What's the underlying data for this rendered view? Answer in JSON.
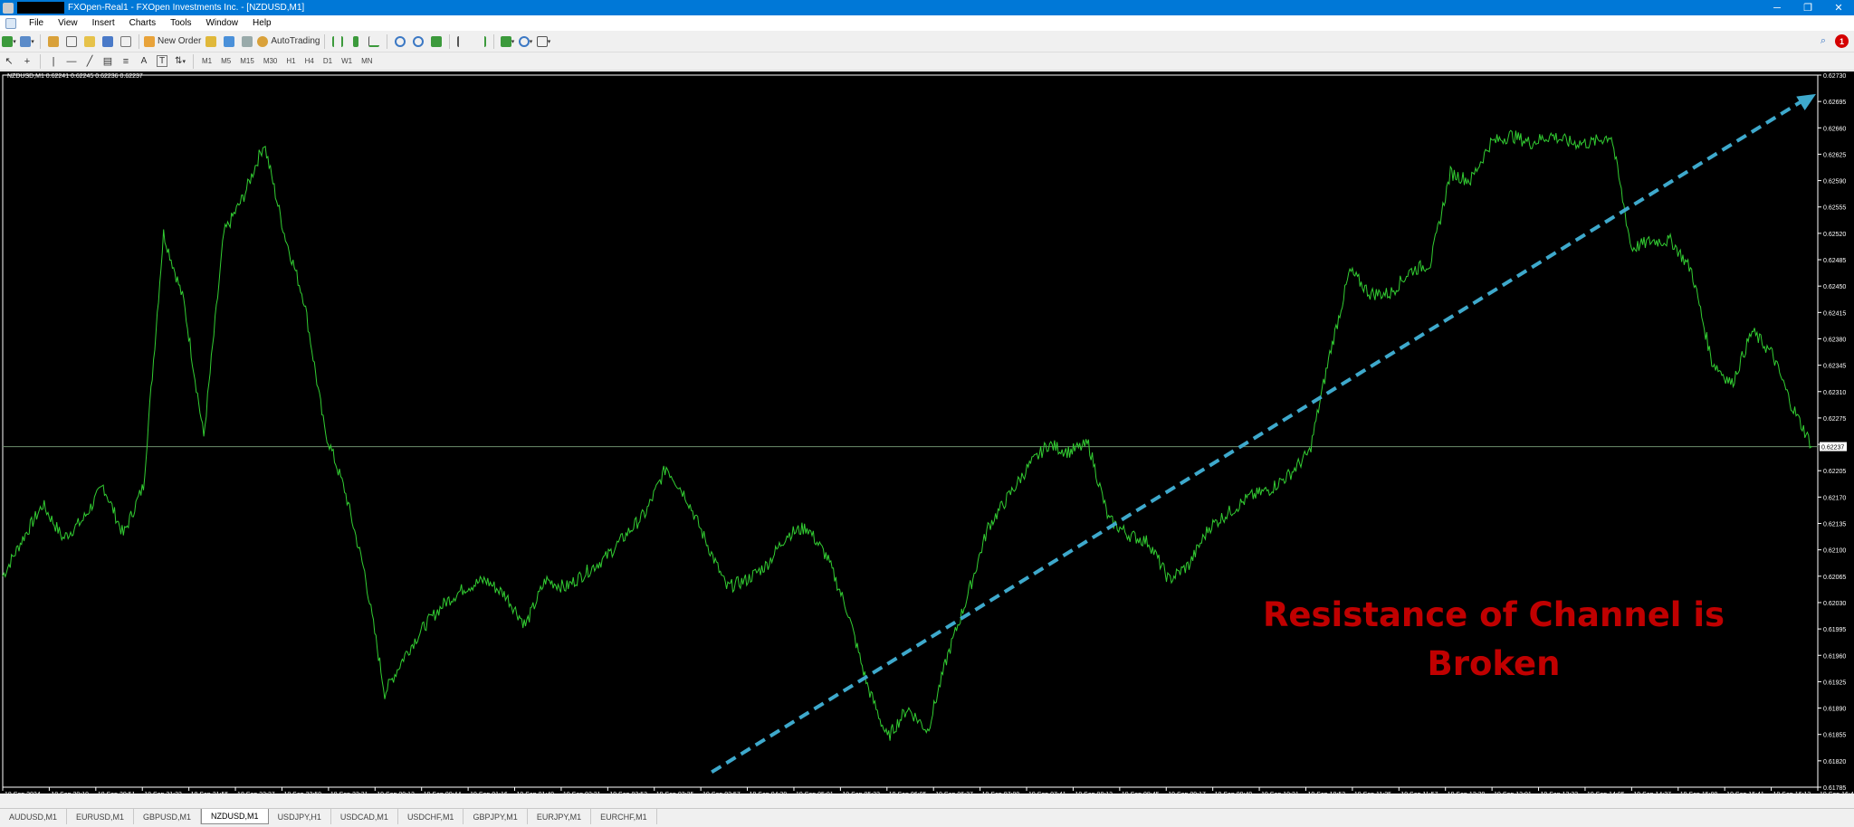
{
  "window": {
    "title": "FXOpen-Real1 - FXOpen Investments Inc. - [NZDUSD,M1]",
    "controls": [
      "─",
      "❐",
      "✕"
    ]
  },
  "menu": {
    "items": [
      "File",
      "View",
      "Insert",
      "Charts",
      "Tools",
      "Window",
      "Help"
    ]
  },
  "toolbar": {
    "new_order_label": "New Order",
    "autotrading_label": "AutoTrading",
    "notification_count": "1",
    "timeframes": [
      "M1",
      "M5",
      "M15",
      "M30",
      "H1",
      "H4",
      "D1",
      "W1",
      "MN"
    ],
    "text_tool": "A",
    "label_tool": "T"
  },
  "chart": {
    "info": "NZDUSD,M1  0.62241 0.62245 0.62236 0.62237",
    "current_price": "0.62237",
    "annotation_line1": "Resistance of Channel is",
    "annotation_line2": "Broken",
    "colors": {
      "background": "#000000",
      "line": "#32cd32",
      "trendline": "#3ea9cc",
      "annotation": "#c00000",
      "price_line": "#6b8e6b"
    }
  },
  "chart_data": {
    "type": "line",
    "symbol": "NZDUSD,M1",
    "ylim": [
      0.61785,
      0.6273
    ],
    "y_ticks": [
      "0.62730",
      "0.62695",
      "0.62660",
      "0.62625",
      "0.62590",
      "0.62555",
      "0.62520",
      "0.62485",
      "0.62450",
      "0.62415",
      "0.62380",
      "0.62345",
      "0.62310",
      "0.62275",
      "0.62240",
      "0.62205",
      "0.62170",
      "0.62135",
      "0.62100",
      "0.62065",
      "0.62030",
      "0.61995",
      "0.61960",
      "0.61925",
      "0.61890",
      "0.61855",
      "0.61820",
      "0.61785"
    ],
    "x_ticks": [
      "18 Sep 2024",
      "18 Sep 20:19",
      "18 Sep 20:51",
      "18 Sep 21:23",
      "18 Sep 21:55",
      "18 Sep 22:27",
      "18 Sep 22:59",
      "18 Sep 23:31",
      "19 Sep 00:12",
      "19 Sep 00:44",
      "19 Sep 01:16",
      "19 Sep 01:49",
      "19 Sep 02:21",
      "19 Sep 02:53",
      "19 Sep 03:25",
      "19 Sep 03:57",
      "19 Sep 04:29",
      "19 Sep 05:01",
      "19 Sep 05:33",
      "19 Sep 06:05",
      "19 Sep 06:37",
      "19 Sep 07:09",
      "19 Sep 07:41",
      "19 Sep 08:13",
      "19 Sep 08:45",
      "19 Sep 09:17",
      "19 Sep 09:49",
      "19 Sep 10:21",
      "19 Sep 10:53",
      "19 Sep 11:25",
      "19 Sep 11:57",
      "19 Sep 12:29",
      "19 Sep 13:01",
      "19 Sep 13:33",
      "19 Sep 14:05",
      "19 Sep 14:37",
      "19 Sep 15:09",
      "19 Sep 15:41",
      "19 Sep 16:13",
      "19 Sep 16:45"
    ],
    "series": [
      {
        "values": [
          0.62065,
          0.62115,
          0.6216,
          0.62115,
          0.6214,
          0.62185,
          0.6212,
          0.62185,
          0.6252,
          0.6243,
          0.6225,
          0.6252,
          0.6257,
          0.6264,
          0.6252,
          0.6243,
          0.6226,
          0.6218,
          0.6207,
          0.6191,
          0.6196,
          0.62,
          0.6203,
          0.6205,
          0.6206,
          0.6204,
          0.62,
          0.6206,
          0.6205,
          0.6207,
          0.6209,
          0.6212,
          0.6215,
          0.6221,
          0.6217,
          0.6211,
          0.6205,
          0.6206,
          0.6208,
          0.6212,
          0.6213,
          0.6209,
          0.6202,
          0.6192,
          0.6185,
          0.6189,
          0.6186,
          0.6196,
          0.6204,
          0.6213,
          0.6217,
          0.6221,
          0.6224,
          0.6223,
          0.6224,
          0.6214,
          0.6212,
          0.6211,
          0.6206,
          0.6208,
          0.6213,
          0.6215,
          0.6217,
          0.6218,
          0.622,
          0.6223,
          0.6236,
          0.6247,
          0.6244,
          0.6244,
          0.6247,
          0.6248,
          0.626,
          0.6259,
          0.6264,
          0.6265,
          0.6264,
          0.6265,
          0.6264,
          0.6264,
          0.6265,
          0.625,
          0.6251,
          0.6251,
          0.6247,
          0.6235,
          0.6232,
          0.6239,
          0.6236,
          0.6229,
          0.62237
        ]
      }
    ],
    "trendline": {
      "from": {
        "x": "19 Sep 03:57",
        "y": 0.61805
      },
      "to": {
        "x": "19 Sep 16:45",
        "y": 0.62705
      }
    },
    "horizontal_line": 0.62237,
    "grid": false
  },
  "tabs": [
    "AUDUSD,M1",
    "EURUSD,M1",
    "GBPUSD,M1",
    "NZDUSD,M1",
    "USDJPY,H1",
    "USDCAD,M1",
    "USDCHF,M1",
    "GBPJPY,M1",
    "EURJPY,M1",
    "EURCHF,M1"
  ],
  "active_tab": "NZDUSD,M1"
}
